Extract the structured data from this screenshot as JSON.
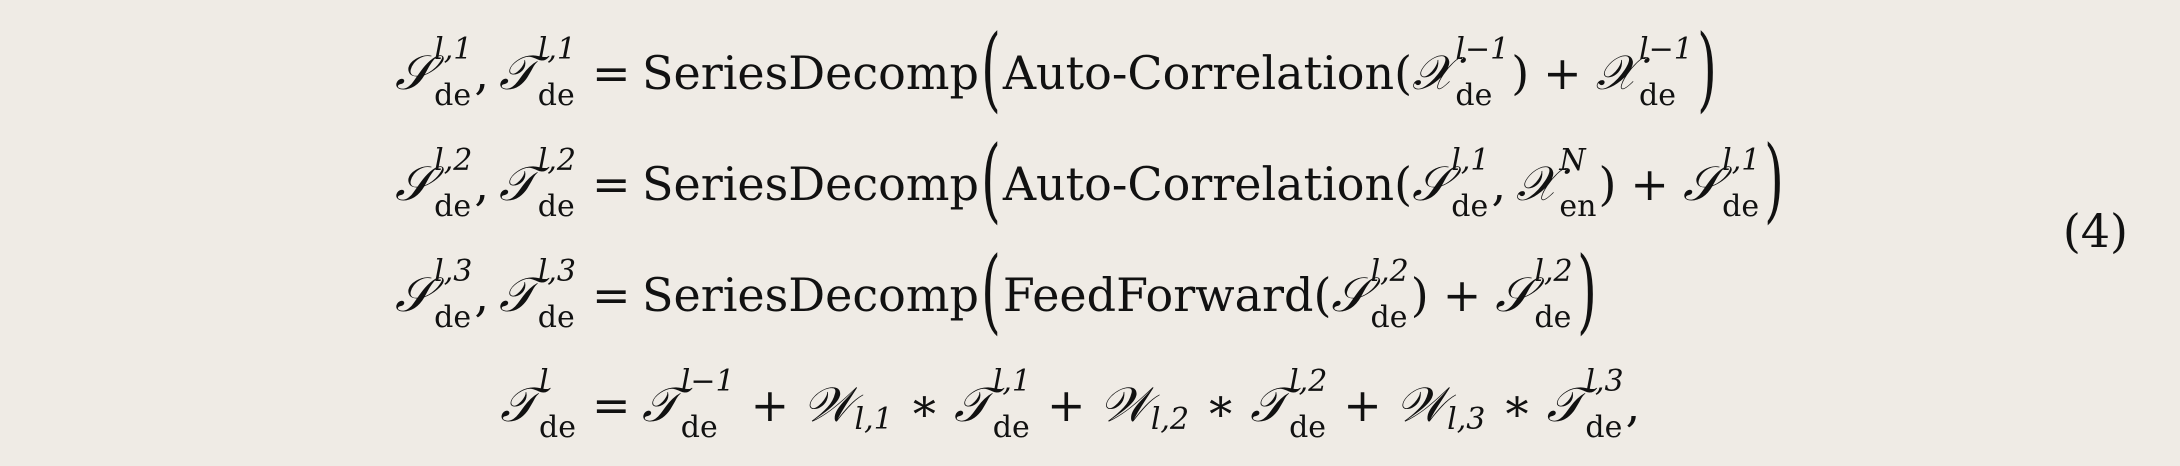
{
  "equation": {
    "symbols": {
      "S": "𝒮",
      "T": "𝒯",
      "X": "𝒳",
      "W": "𝒲",
      "de": "de",
      "en": "en",
      "equals": "=",
      "plus": "+",
      "star": "∗",
      "comma": ",",
      "lparen": "(",
      "rparen": ")",
      "big_lparen": "(",
      "big_rparen": ")"
    },
    "functions": {
      "series_decomp": "SeriesDecomp",
      "auto_correlation": "Auto-Correlation",
      "feed_forward": "FeedForward"
    },
    "superscripts": {
      "l1": "l,1",
      "l2": "l,2",
      "l3": "l,3",
      "l": "l",
      "lminus1": "l−1",
      "N": "N"
    },
    "subscripts": {
      "w1": "l,1",
      "w2": "l,2",
      "w3": "l,3"
    },
    "trailing_comma": ",",
    "number": "(4)"
  }
}
